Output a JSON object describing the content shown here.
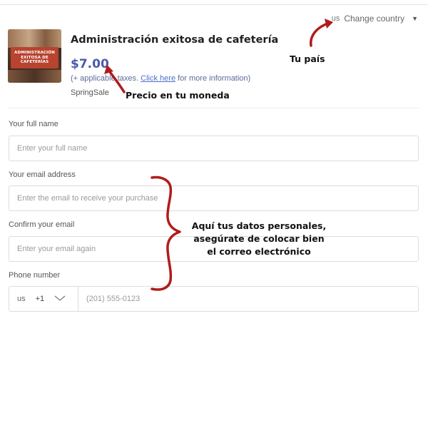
{
  "header": {
    "country_code": "us",
    "change_country_label": "Change country"
  },
  "product": {
    "thumbnail_lines": [
      "ADMINISTRACIÓN",
      "EXITOSA DE",
      "CAFETERÍAS"
    ],
    "title": "Administración exitosa de cafetería",
    "price": "$7.00",
    "tax_prefix": "(+ applicable taxes.",
    "tax_link": "Click here",
    "tax_suffix": " for more information)",
    "coupon": "SpringSale"
  },
  "form": {
    "full_name": {
      "label": "Your full name",
      "placeholder": "Enter your full name"
    },
    "email": {
      "label": "Your email address",
      "placeholder": "Enter the email to receive your purchase"
    },
    "confirm_email": {
      "label": "Confirm your email",
      "placeholder": "Enter your email again"
    },
    "phone": {
      "label": "Phone number",
      "country_code": "us",
      "dial_code": "+1",
      "placeholder": "(201) 555-0123"
    }
  },
  "annotations": {
    "country": "Tu país",
    "currency": "Precio en tu moneda",
    "personal_data": [
      "Aquí tus datos personales,",
      "asegúrate de colocar bien",
      "el correo electrónico"
    ],
    "color": "#b01c1c"
  },
  "colors": {
    "price": "#4a5aa8",
    "link": "#4a6fd0",
    "field_border": "#dcdcdc"
  }
}
